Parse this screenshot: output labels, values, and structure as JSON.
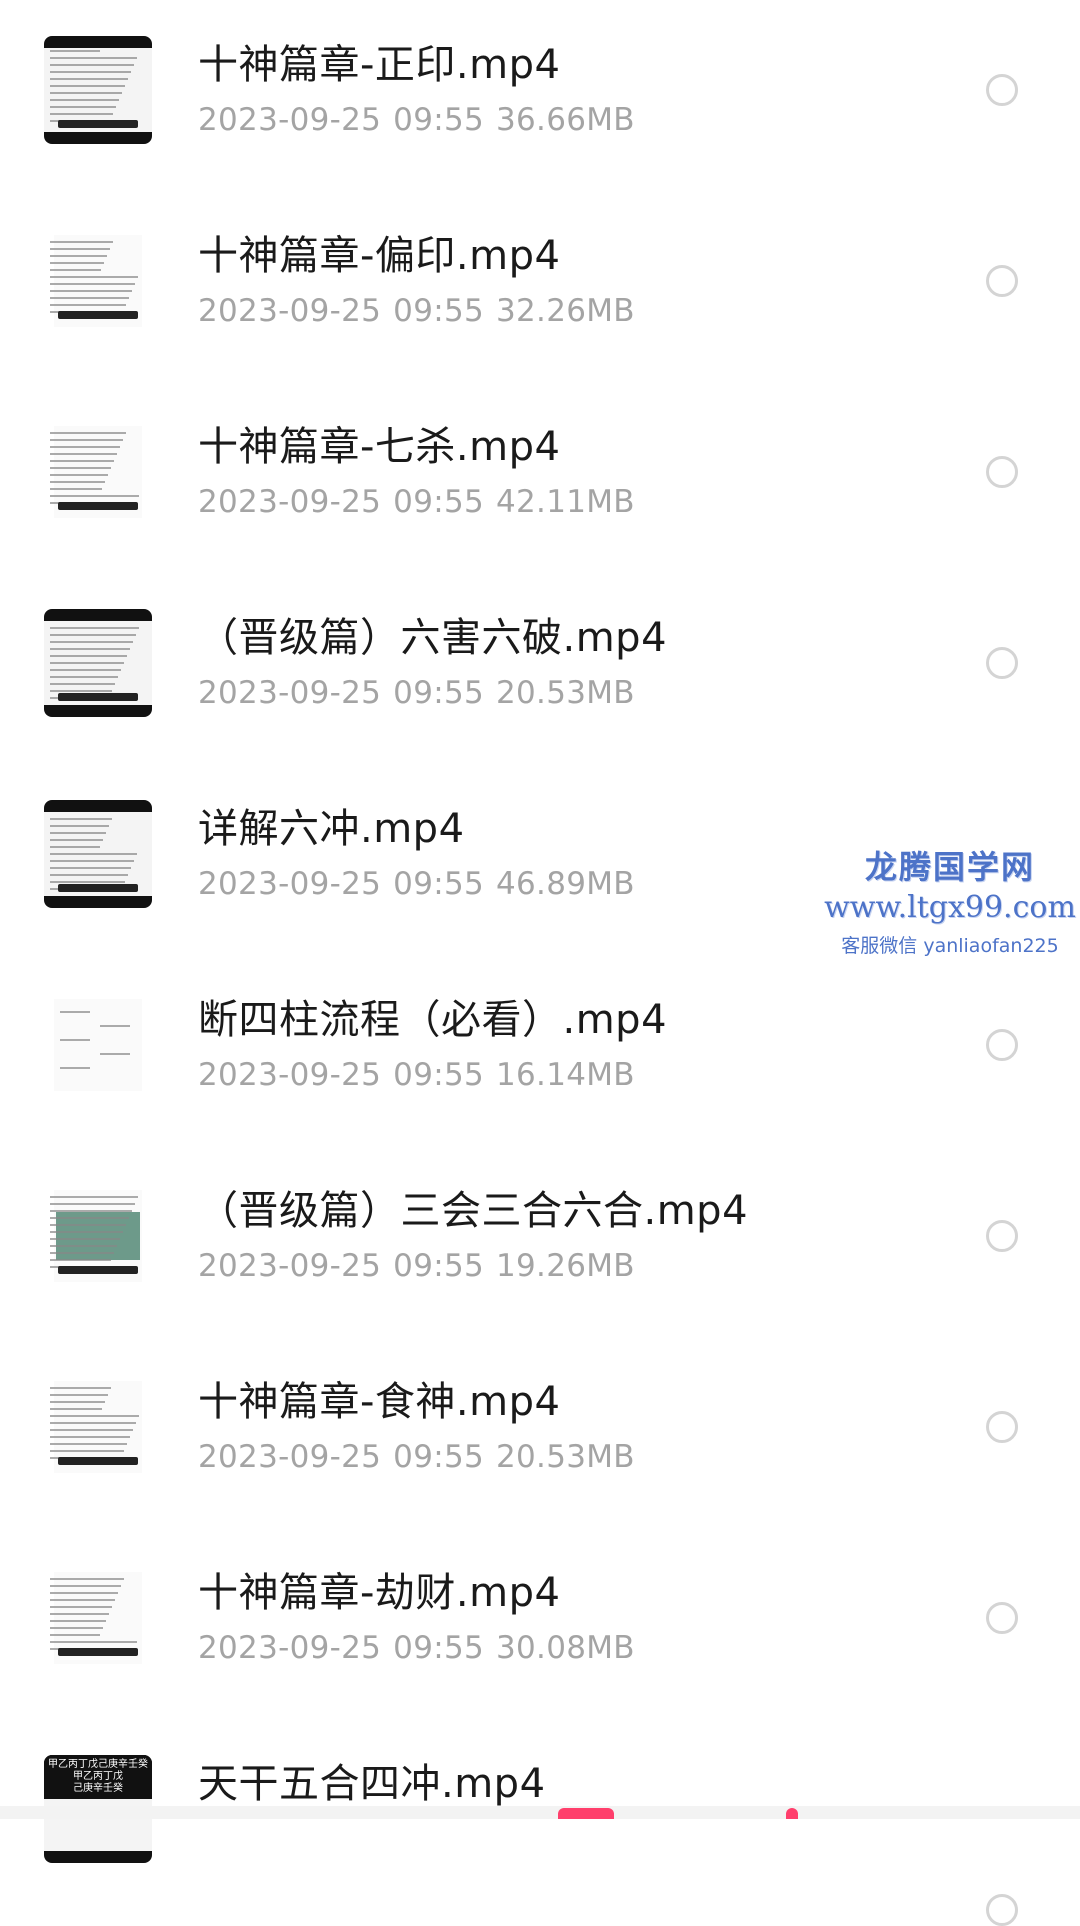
{
  "files": [
    {
      "name": "十神篇章-正印.mp4",
      "date": "2023-09-25",
      "time": "09:55",
      "size": "36.66MB",
      "thumb": "table"
    },
    {
      "name": "十神篇章-偏印.mp4",
      "date": "2023-09-25",
      "time": "09:55",
      "size": "32.26MB",
      "thumb": "text"
    },
    {
      "name": "十神篇章-七杀.mp4",
      "date": "2023-09-25",
      "time": "09:55",
      "size": "42.11MB",
      "thumb": "text"
    },
    {
      "name": "（晋级篇）六害六破.mp4",
      "date": "2023-09-25",
      "time": "09:55",
      "size": "20.53MB",
      "thumb": "dark"
    },
    {
      "name": "详解六冲.mp4",
      "date": "2023-09-25",
      "time": "09:55",
      "size": "46.89MB",
      "thumb": "dark"
    },
    {
      "name": "断四柱流程（必看）.mp4",
      "date": "2023-09-25",
      "time": "09:55",
      "size": "16.14MB",
      "thumb": "light"
    },
    {
      "name": "（晋级篇）三会三合六合.mp4",
      "date": "2023-09-25",
      "time": "09:55",
      "size": "19.26MB",
      "thumb": "green"
    },
    {
      "name": "十神篇章-食神.mp4",
      "date": "2023-09-25",
      "time": "09:55",
      "size": "20.53MB",
      "thumb": "text"
    },
    {
      "name": "十神篇章-劫财.mp4",
      "date": "2023-09-25",
      "time": "09:55",
      "size": "30.08MB",
      "thumb": "text"
    },
    {
      "name": "天干五合四冲.mp4",
      "date": "",
      "time": "",
      "size": "",
      "thumb": "slab"
    }
  ],
  "watermark": {
    "title": "龙腾国学网",
    "url": "www.ltgx99.com",
    "contact": "客服微信 yanliaofan225"
  },
  "thumb_slab_text": [
    "甲乙丙丁戊己庚辛壬癸",
    "甲乙丙丁戊",
    "己庚辛壬癸"
  ],
  "colors": {
    "name": "#1a1a1a",
    "meta": "#a4a4a4",
    "radio_border": "#d4d4d4",
    "watermark": "#4d73c8"
  }
}
